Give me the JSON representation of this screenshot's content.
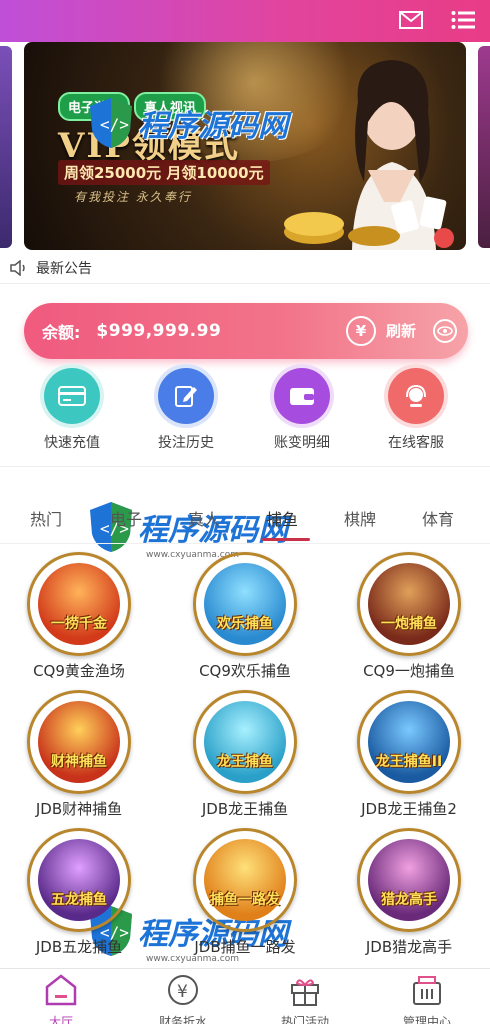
{
  "header": {
    "icons": [
      "mail-icon",
      "menu-icon"
    ],
    "gradient": [
      "#c04fd8",
      "#e83c86"
    ]
  },
  "banner": {
    "tag_1": "电子游戏",
    "tag_2": "真人视讯",
    "headline": "VIP领模式",
    "promo": "周领25000元 月领10000元",
    "slogan": "有我投注 永久奉行"
  },
  "watermark": {
    "brand": "程序源码网",
    "url": "www.cxyuanma.com"
  },
  "notice": {
    "text": "最新公告"
  },
  "balance": {
    "label": "余额:",
    "amount": "$999,999.99",
    "refresh": "刷新",
    "yen_symbol": "¥"
  },
  "actions": [
    {
      "label": "快速充值",
      "color": "#3cc8c0",
      "icon": "card-icon"
    },
    {
      "label": "投注历史",
      "color": "#4a7de8",
      "icon": "edit-icon"
    },
    {
      "label": "账变明细",
      "color": "#a64de0",
      "icon": "wallet-icon"
    },
    {
      "label": "在线客服",
      "color": "#f06a6a",
      "icon": "headset-icon"
    }
  ],
  "tabs": [
    {
      "label": "热门"
    },
    {
      "label": "电子"
    },
    {
      "label": "真人"
    },
    {
      "label": "捕鱼",
      "active": true
    },
    {
      "label": "棋牌"
    },
    {
      "label": "体育"
    }
  ],
  "games": [
    {
      "name": "CQ9黄金渔场",
      "art_text": "一捞千金",
      "color": "#d23a1a"
    },
    {
      "name": "CQ9欢乐捕鱼",
      "art_text": "欢乐捕鱼",
      "color": "#2a8ad0"
    },
    {
      "name": "CQ9一炮捕鱼",
      "art_text": "一炮捕鱼",
      "color": "#7a2a1a"
    },
    {
      "name": "JDB财神捕鱼",
      "art_text": "财神捕鱼",
      "color": "#c8321a"
    },
    {
      "name": "JDB龙王捕鱼",
      "art_text": "龙王捕鱼",
      "color": "#2aa0c8"
    },
    {
      "name": "JDB龙王捕鱼2",
      "art_text": "龙王捕鱼II",
      "color": "#1a5aa0"
    },
    {
      "name": "JDB五龙捕鱼",
      "art_text": "五龙捕鱼",
      "color": "#5a2a8a"
    },
    {
      "name": "JDB捕鱼一路发",
      "art_text": "捕鱼一路发",
      "color": "#e0801a"
    },
    {
      "name": "JDB猎龙高手",
      "art_text": "猎龙高手",
      "color": "#6a2a7a"
    }
  ],
  "bottom_nav": [
    {
      "label": "大厅",
      "active": true
    },
    {
      "label": "财务折水"
    },
    {
      "label": "热门活动"
    },
    {
      "label": "管理中心"
    }
  ]
}
